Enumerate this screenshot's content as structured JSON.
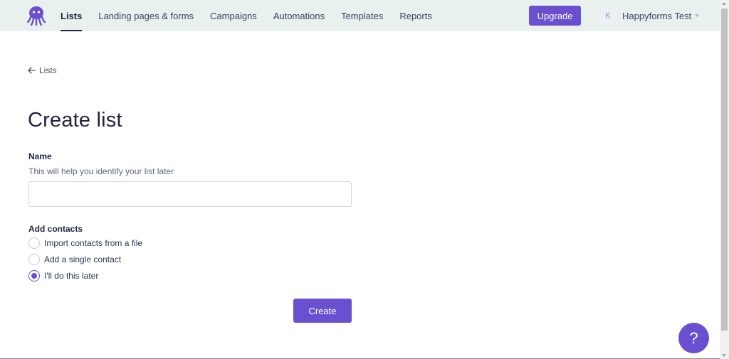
{
  "colors": {
    "accent": "#6a4fd1",
    "topbar_bg": "#e8f1ee",
    "text": "#1f2340"
  },
  "header": {
    "logo_icon": "octopus-logo-icon",
    "nav": [
      {
        "label": "Lists",
        "active": true
      },
      {
        "label": "Landing pages & forms",
        "active": false
      },
      {
        "label": "Campaigns",
        "active": false
      },
      {
        "label": "Automations",
        "active": false
      },
      {
        "label": "Templates",
        "active": false
      },
      {
        "label": "Reports",
        "active": false
      }
    ],
    "upgrade_label": "Upgrade",
    "account": {
      "avatar_initial": "K",
      "name": "Happyforms Test",
      "dropdown_icon": "caret-down-icon"
    }
  },
  "breadcrumb": {
    "back_icon": "arrow-left-icon",
    "label": "Lists"
  },
  "page": {
    "title": "Create list"
  },
  "form": {
    "name": {
      "label": "Name",
      "help": "This will help you identify your list later",
      "value": "",
      "placeholder": ""
    },
    "contacts": {
      "label": "Add contacts",
      "options": [
        {
          "label": "Import contacts from a file",
          "checked": false
        },
        {
          "label": "Add a single contact",
          "checked": false
        },
        {
          "label": "I'll do this later",
          "checked": true
        }
      ]
    },
    "submit_label": "Create"
  },
  "help": {
    "label": "?",
    "icon": "help-icon"
  }
}
